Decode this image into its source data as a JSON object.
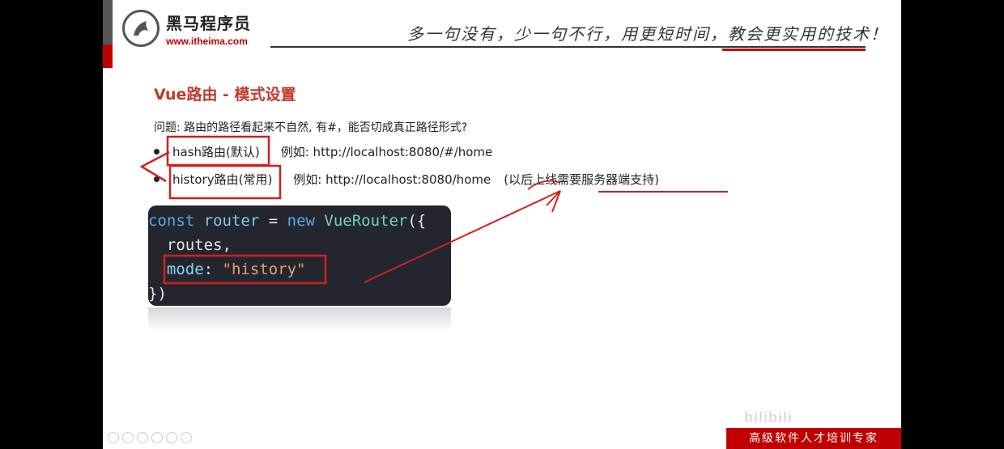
{
  "header": {
    "logo_text": "黑马程序员",
    "logo_url": "www.itheima.com",
    "slogan": "多一句没有，少一句不行，用更短时间，教会更实用的技术！"
  },
  "slide": {
    "title": "Vue路由 - 模式设置",
    "question": "问题: 路由的路径看起来不自然, 有#，能否切成真正路径形式?",
    "bullets": [
      {
        "term": "hash路由(默认)",
        "example": "例如:  http://localhost:8080/#/home",
        "note": ""
      },
      {
        "term": "history路由(常用)",
        "example": "例如:  http://localhost:8080/home",
        "note": "(以后上线需要服务器端支持)"
      }
    ]
  },
  "code": {
    "line1": {
      "k1": "const",
      "v1": "router",
      "eq": " = ",
      "k2": "new",
      "fn": "VueRouter",
      "p": "({"
    },
    "line2": "  routes,",
    "line3": {
      "prop": "mode",
      "colon": ": ",
      "str": "\"history\""
    },
    "line4": "})"
  },
  "footer": {
    "tagline": "高级软件人才培训专家",
    "watermark": "bilibili"
  },
  "colors": {
    "accent": "#c00000",
    "title": "#c0392b",
    "code_bg": "#23262e"
  }
}
